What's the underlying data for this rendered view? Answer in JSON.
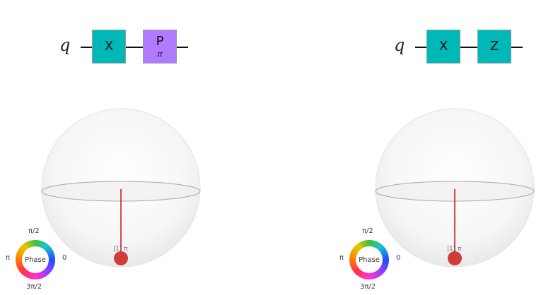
{
  "panels": [
    {
      "qubit_label": "q",
      "gates": [
        {
          "label": "X",
          "param": "",
          "color": "#00b8b8"
        },
        {
          "label": "P",
          "param": "π",
          "color": "#b07bff"
        }
      ],
      "state_label": "|1⟩ π",
      "phase_wheel": {
        "center": "Phase",
        "top": "π/2",
        "left": "π",
        "right": "0",
        "bottom": "3π/2"
      }
    },
    {
      "qubit_label": "q",
      "gates": [
        {
          "label": "X",
          "param": "",
          "color": "#00b8b8"
        },
        {
          "label": "Z",
          "param": "",
          "color": "#00b8b8"
        }
      ],
      "state_label": "|1⟩ π",
      "phase_wheel": {
        "center": "Phase",
        "top": "π/2",
        "left": "π",
        "right": "0",
        "bottom": "3π/2"
      }
    }
  ],
  "colors": {
    "state_vector": "#cc1f1f",
    "state_point": "#d13b3b"
  }
}
